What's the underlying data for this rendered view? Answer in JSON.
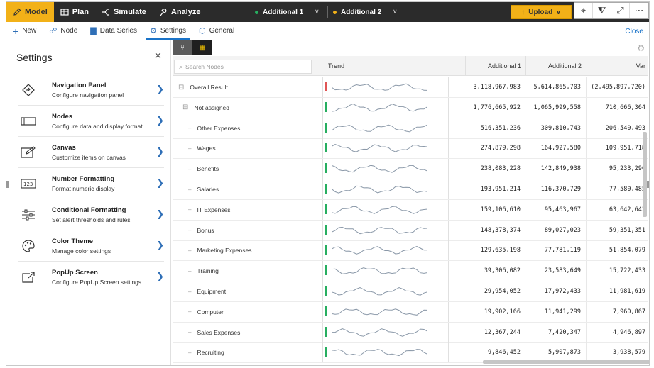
{
  "topbar": {
    "modes": [
      {
        "label": "Model",
        "icon": "pencil-icon",
        "active": true
      },
      {
        "label": "Plan",
        "icon": "table-icon",
        "active": false
      },
      {
        "label": "Simulate",
        "icon": "simulate-icon",
        "active": false
      },
      {
        "label": "Analyze",
        "icon": "analyze-icon",
        "active": false
      }
    ],
    "scenarios": [
      {
        "label": "Additional 1",
        "color": "#27ae60"
      },
      {
        "label": "Additional 2",
        "color": "#f2b118"
      }
    ],
    "upload_label": "Upload"
  },
  "subbar": {
    "items": [
      {
        "label": "New",
        "icon": "plus-icon"
      },
      {
        "label": "Node",
        "icon": "node-icon"
      },
      {
        "label": "Data Series",
        "icon": "data-series-icon"
      },
      {
        "label": "Settings",
        "icon": "gear-icon"
      },
      {
        "label": "General",
        "icon": "cube-icon"
      }
    ],
    "close_label": "Close"
  },
  "settings": {
    "title": "Settings",
    "items": [
      {
        "title": "Navigation Panel",
        "desc": "Configure navigation panel",
        "icon": "navigation-icon"
      },
      {
        "title": "Nodes",
        "desc": "Configure data and display format",
        "icon": "nodes-icon"
      },
      {
        "title": "Canvas",
        "desc": "Customize items on canvas",
        "icon": "canvas-icon"
      },
      {
        "title": "Number Formatting",
        "desc": "Format numeric display",
        "icon": "number-format-icon"
      },
      {
        "title": "Conditional Formatting",
        "desc": "Set alert thresholds and rules",
        "icon": "sliders-icon"
      },
      {
        "title": "Color Theme",
        "desc": "Manage color settings",
        "icon": "palette-icon"
      },
      {
        "title": "PopUp Screen",
        "desc": "Configure PopUp Screen settings",
        "icon": "popup-icon"
      }
    ]
  },
  "grid": {
    "search_placeholder": "Search Nodes",
    "headers": {
      "trend": "Trend",
      "c1": "Additional 1",
      "c2": "Additional 2",
      "c3": "Var"
    },
    "rows": [
      {
        "name": "Overall Result",
        "level": 0,
        "expander": "⊟",
        "flag": "#e05555",
        "c1": "3,118,967,983",
        "c2": "5,614,865,703",
        "c3": "(2,495,897,720)"
      },
      {
        "name": "Not assigned",
        "level": 1,
        "expander": "⊟",
        "flag": "#27ae60",
        "c1": "1,776,665,922",
        "c2": "1,065,999,558",
        "c3": "710,666,364"
      },
      {
        "name": "Other Expenses",
        "level": 2,
        "expander": "–",
        "flag": "#27ae60",
        "c1": "516,351,236",
        "c2": "309,810,743",
        "c3": "206,540,493"
      },
      {
        "name": "Wages",
        "level": 2,
        "expander": "–",
        "flag": "#27ae60",
        "c1": "274,879,298",
        "c2": "164,927,580",
        "c3": "109,951,718"
      },
      {
        "name": "Benefits",
        "level": 2,
        "expander": "–",
        "flag": "#27ae60",
        "c1": "238,083,228",
        "c2": "142,849,938",
        "c3": "95,233,290"
      },
      {
        "name": "Salaries",
        "level": 2,
        "expander": "–",
        "flag": "#27ae60",
        "c1": "193,951,214",
        "c2": "116,370,729",
        "c3": "77,580,485"
      },
      {
        "name": "IT Expenses",
        "level": 2,
        "expander": "–",
        "flag": "#27ae60",
        "c1": "159,106,610",
        "c2": "95,463,967",
        "c3": "63,642,643"
      },
      {
        "name": "Bonus",
        "level": 2,
        "expander": "–",
        "flag": "#27ae60",
        "c1": "148,378,374",
        "c2": "89,027,023",
        "c3": "59,351,351"
      },
      {
        "name": "Marketing Expenses",
        "level": 2,
        "expander": "–",
        "flag": "#27ae60",
        "c1": "129,635,198",
        "c2": "77,781,119",
        "c3": "51,854,079"
      },
      {
        "name": "Training",
        "level": 2,
        "expander": "–",
        "flag": "#27ae60",
        "c1": "39,306,082",
        "c2": "23,583,649",
        "c3": "15,722,433"
      },
      {
        "name": "Equipment",
        "level": 2,
        "expander": "–",
        "flag": "#27ae60",
        "c1": "29,954,052",
        "c2": "17,972,433",
        "c3": "11,981,619"
      },
      {
        "name": "Computer",
        "level": 2,
        "expander": "–",
        "flag": "#27ae60",
        "c1": "19,902,166",
        "c2": "11,941,299",
        "c3": "7,960,867"
      },
      {
        "name": "Sales Expenses",
        "level": 2,
        "expander": "–",
        "flag": "#27ae60",
        "c1": "12,367,244",
        "c2": "7,420,347",
        "c3": "4,946,897"
      },
      {
        "name": "Recruiting",
        "level": 2,
        "expander": "–",
        "flag": "#27ae60",
        "c1": "9,846,452",
        "c2": "5,907,873",
        "c3": "3,938,579"
      }
    ]
  }
}
